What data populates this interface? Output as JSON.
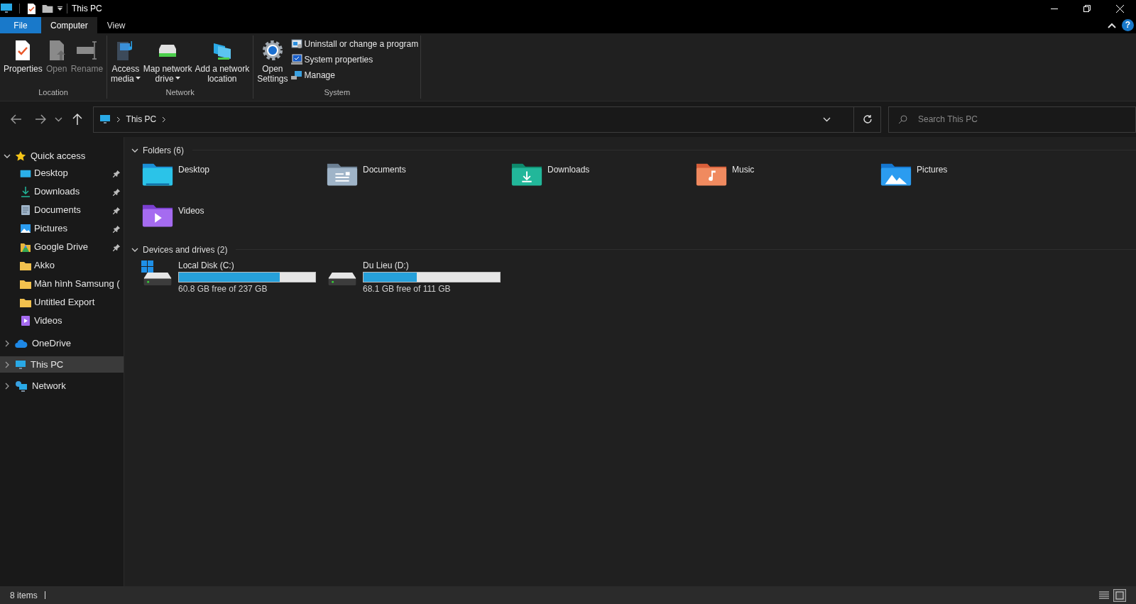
{
  "window": {
    "title": "This PC",
    "help_label": "?"
  },
  "ribbon_tabs": [
    {
      "label": "File",
      "kind": "file",
      "selected": false
    },
    {
      "label": "Computer",
      "kind": "tab",
      "selected": true
    },
    {
      "label": "View",
      "kind": "tab",
      "selected": false
    }
  ],
  "ribbon_groups": [
    {
      "label": "Location",
      "commands": [
        {
          "label": "Properties",
          "kind": "large",
          "disabled": false,
          "dropdown": false
        },
        {
          "label": "Open",
          "kind": "large",
          "disabled": true,
          "dropdown": false
        },
        {
          "label": "Rename",
          "kind": "large",
          "disabled": true,
          "dropdown": false
        }
      ]
    },
    {
      "label": "Network",
      "commands": [
        {
          "label": "Access\nmedia",
          "kind": "large",
          "disabled": false,
          "dropdown": true
        },
        {
          "label": "Map network\ndrive",
          "kind": "large",
          "disabled": false,
          "dropdown": true
        },
        {
          "label": "Add a network\nlocation",
          "kind": "large",
          "disabled": false,
          "dropdown": false
        }
      ]
    },
    {
      "label": "System",
      "commands": [
        {
          "label": "Open\nSettings",
          "kind": "large",
          "disabled": false,
          "dropdown": false
        },
        {
          "label": "Uninstall or change a program",
          "kind": "small",
          "disabled": false,
          "dropdown": false
        },
        {
          "label": "System properties",
          "kind": "small",
          "disabled": false,
          "dropdown": false
        },
        {
          "label": "Manage",
          "kind": "small",
          "disabled": false,
          "dropdown": false
        }
      ]
    }
  ],
  "address_bar": {
    "location": "This PC"
  },
  "search": {
    "placeholder": "Search This PC"
  },
  "sidebar": {
    "items": [
      {
        "label": "Quick access",
        "kind": "star",
        "expanded": true,
        "selected": false,
        "children": [
          {
            "label": "Desktop",
            "kind": "desktop",
            "pinned": true,
            "selected": false
          },
          {
            "label": "Downloads",
            "kind": "downloads",
            "pinned": true,
            "selected": false
          },
          {
            "label": "Documents",
            "kind": "documents",
            "pinned": true,
            "selected": false
          },
          {
            "label": "Pictures",
            "kind": "pictures",
            "pinned": true,
            "selected": false
          },
          {
            "label": "Google Drive",
            "kind": "gdrive",
            "pinned": true,
            "selected": false
          },
          {
            "label": "Akko",
            "kind": "folder",
            "pinned": false,
            "selected": false
          },
          {
            "label": "Màn hình Samsung (",
            "kind": "folder",
            "pinned": false,
            "selected": false
          },
          {
            "label": "Untitled Export",
            "kind": "folder",
            "pinned": false,
            "selected": false
          },
          {
            "label": "Videos",
            "kind": "videos",
            "pinned": false,
            "selected": false
          }
        ]
      },
      {
        "label": "OneDrive",
        "kind": "onedrive",
        "expanded": false,
        "selected": false
      },
      {
        "label": "This PC",
        "kind": "pc",
        "expanded": false,
        "selected": true
      },
      {
        "label": "Network",
        "kind": "network",
        "expanded": false,
        "selected": false
      }
    ]
  },
  "folders": {
    "heading": "Folders (6)",
    "items": [
      {
        "label": "Desktop",
        "kind": "desktop"
      },
      {
        "label": "Documents",
        "kind": "documents"
      },
      {
        "label": "Downloads",
        "kind": "downloads"
      },
      {
        "label": "Music",
        "kind": "music"
      },
      {
        "label": "Pictures",
        "kind": "pictures"
      },
      {
        "label": "Videos",
        "kind": "videos"
      }
    ]
  },
  "drives": {
    "heading": "Devices and drives (2)",
    "items": [
      {
        "label": "Local Disk (C:)",
        "system": true,
        "level": 0.74,
        "free": "60.8 GB free of 237 GB"
      },
      {
        "label": "Du Lieu (D:)",
        "system": false,
        "level": 0.39,
        "free": "68.1 GB free of 111 GB"
      }
    ]
  },
  "status_bar": {
    "count": "8 items",
    "view_buttons": [
      {
        "kind": "details",
        "selected": false
      },
      {
        "kind": "large-icons",
        "selected": true
      }
    ]
  }
}
